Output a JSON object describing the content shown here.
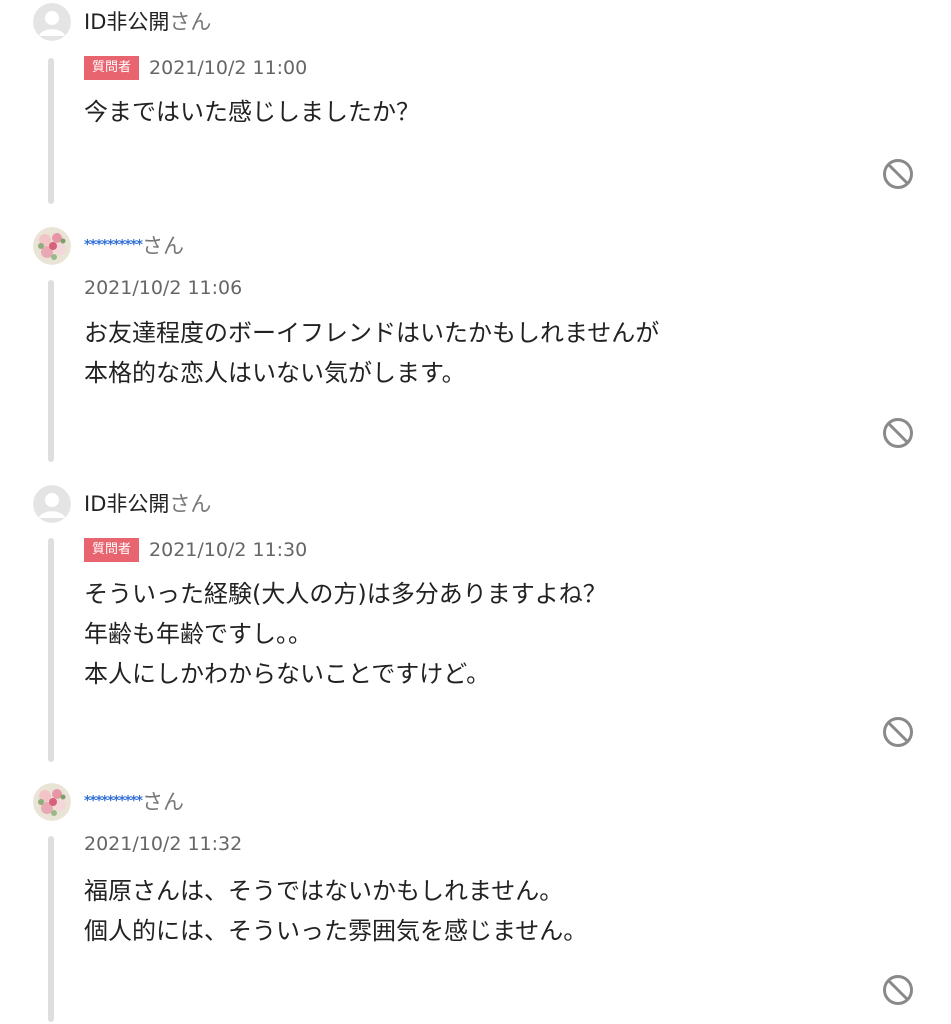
{
  "comments": [
    {
      "user_type": "anonymous",
      "username": "ID非公開",
      "honorific": "さん",
      "badge": "質問者",
      "timestamp": "2021/10/2 11:00",
      "body": "今まではいた感じしましたか？"
    },
    {
      "user_type": "masked",
      "username": "**********",
      "honorific": "さん",
      "badge": "",
      "timestamp": "2021/10/2 11:06",
      "body": "お友達程度のボーイフレンドはいたかもしれませんが\n本格的な恋人はいない気がします。"
    },
    {
      "user_type": "anonymous",
      "username": "ID非公開",
      "honorific": "さん",
      "badge": "質問者",
      "timestamp": "2021/10/2 11:30",
      "body": "そういった経験(大人の方)は多分ありますよね？\n年齢も年齢ですし。。\n本人にしかわからないことですけど。"
    },
    {
      "user_type": "masked",
      "username": "**********",
      "honorific": "さん",
      "badge": "",
      "timestamp": "2021/10/2 11:32",
      "body": "福原さんは、そうではないかもしれません。\n個人的には、そういった雰囲気を感じません。"
    }
  ],
  "icons": {
    "default_avatar": "default-avatar-icon",
    "flower_avatar": "flower-avatar-icon",
    "block": "block-icon"
  },
  "colors": {
    "badge_bg": "#e8646f",
    "masked_name": "#2f6fd6",
    "rail": "#dedede",
    "icon": "#8a8a8a"
  }
}
